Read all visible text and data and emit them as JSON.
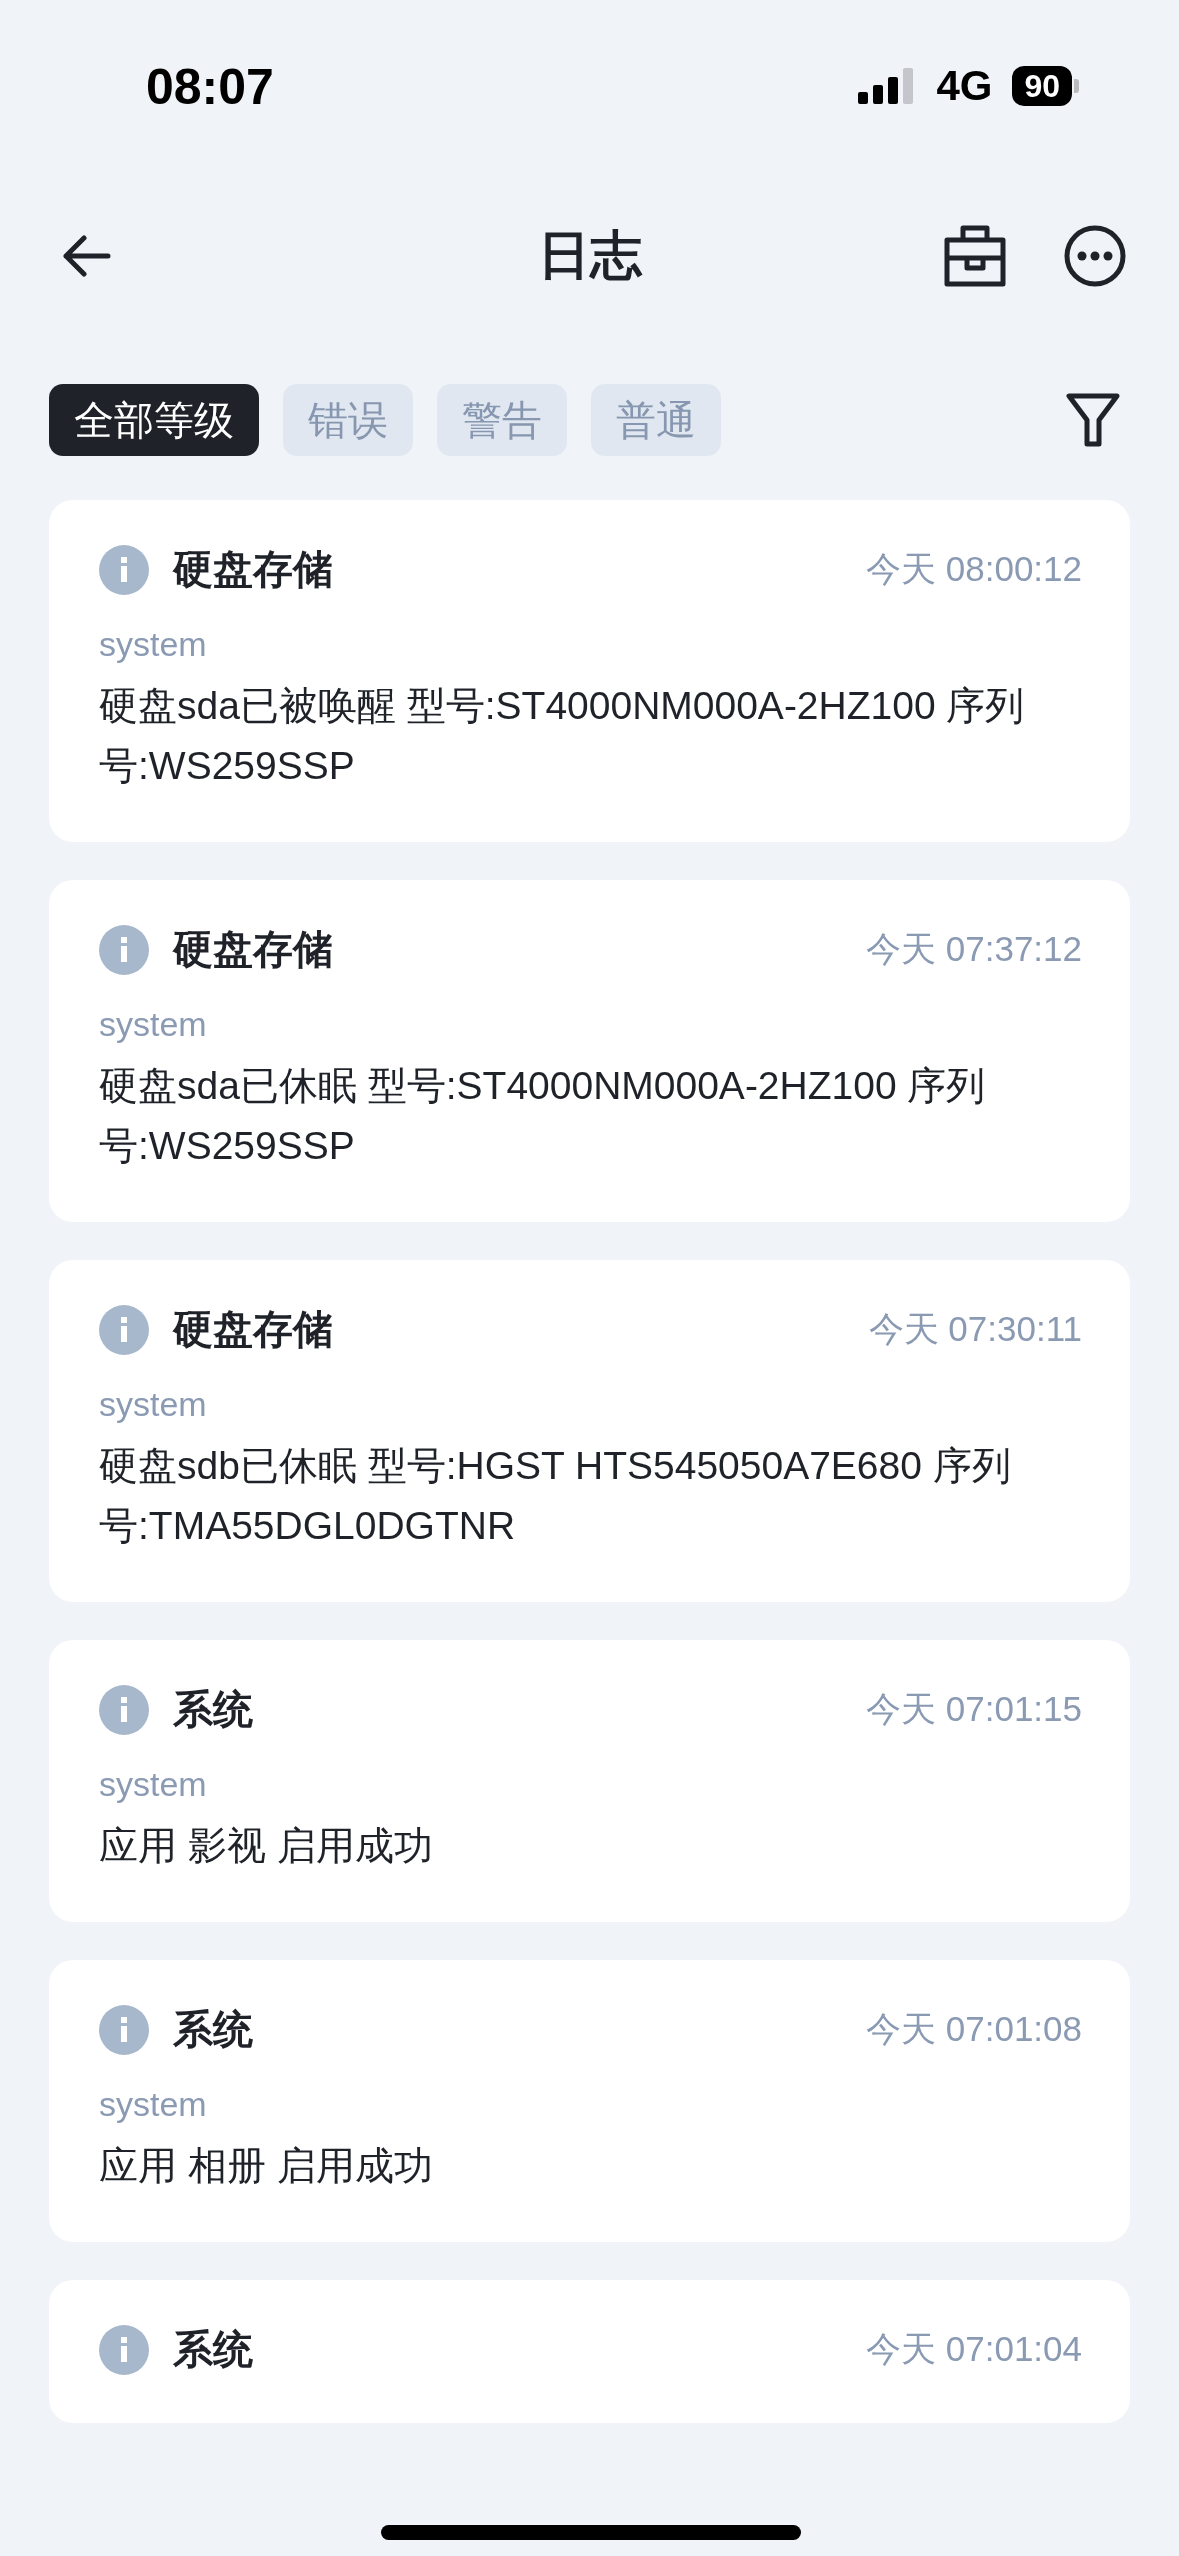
{
  "status_bar": {
    "time": "08:07",
    "network": "4G",
    "battery": "90"
  },
  "nav": {
    "title": "日志"
  },
  "filters": [
    {
      "label": "全部等级",
      "selected": true
    },
    {
      "label": "错误",
      "selected": false
    },
    {
      "label": "警告",
      "selected": false
    },
    {
      "label": "普通",
      "selected": false
    }
  ],
  "logs": [
    {
      "title": "硬盘存储",
      "time": "今天 08:00:12",
      "source": "system",
      "message": "硬盘sda已被唤醒 型号:ST4000NM000A-2HZ100 序列号:WS259SSP"
    },
    {
      "title": "硬盘存储",
      "time": "今天 07:37:12",
      "source": "system",
      "message": "硬盘sda已休眠 型号:ST4000NM000A-2HZ100 序列号:WS259SSP"
    },
    {
      "title": "硬盘存储",
      "time": "今天 07:30:11",
      "source": "system",
      "message": "硬盘sdb已休眠 型号:HGST HTS545050A7E680 序列号:TMA55DGL0DGTNR"
    },
    {
      "title": "系统",
      "time": "今天 07:01:15",
      "source": "system",
      "message": "应用 影视 启用成功"
    },
    {
      "title": "系统",
      "time": "今天 07:01:08",
      "source": "system",
      "message": "应用 相册 启用成功"
    },
    {
      "title": "系统",
      "time": "今天 07:01:04"
    }
  ]
}
